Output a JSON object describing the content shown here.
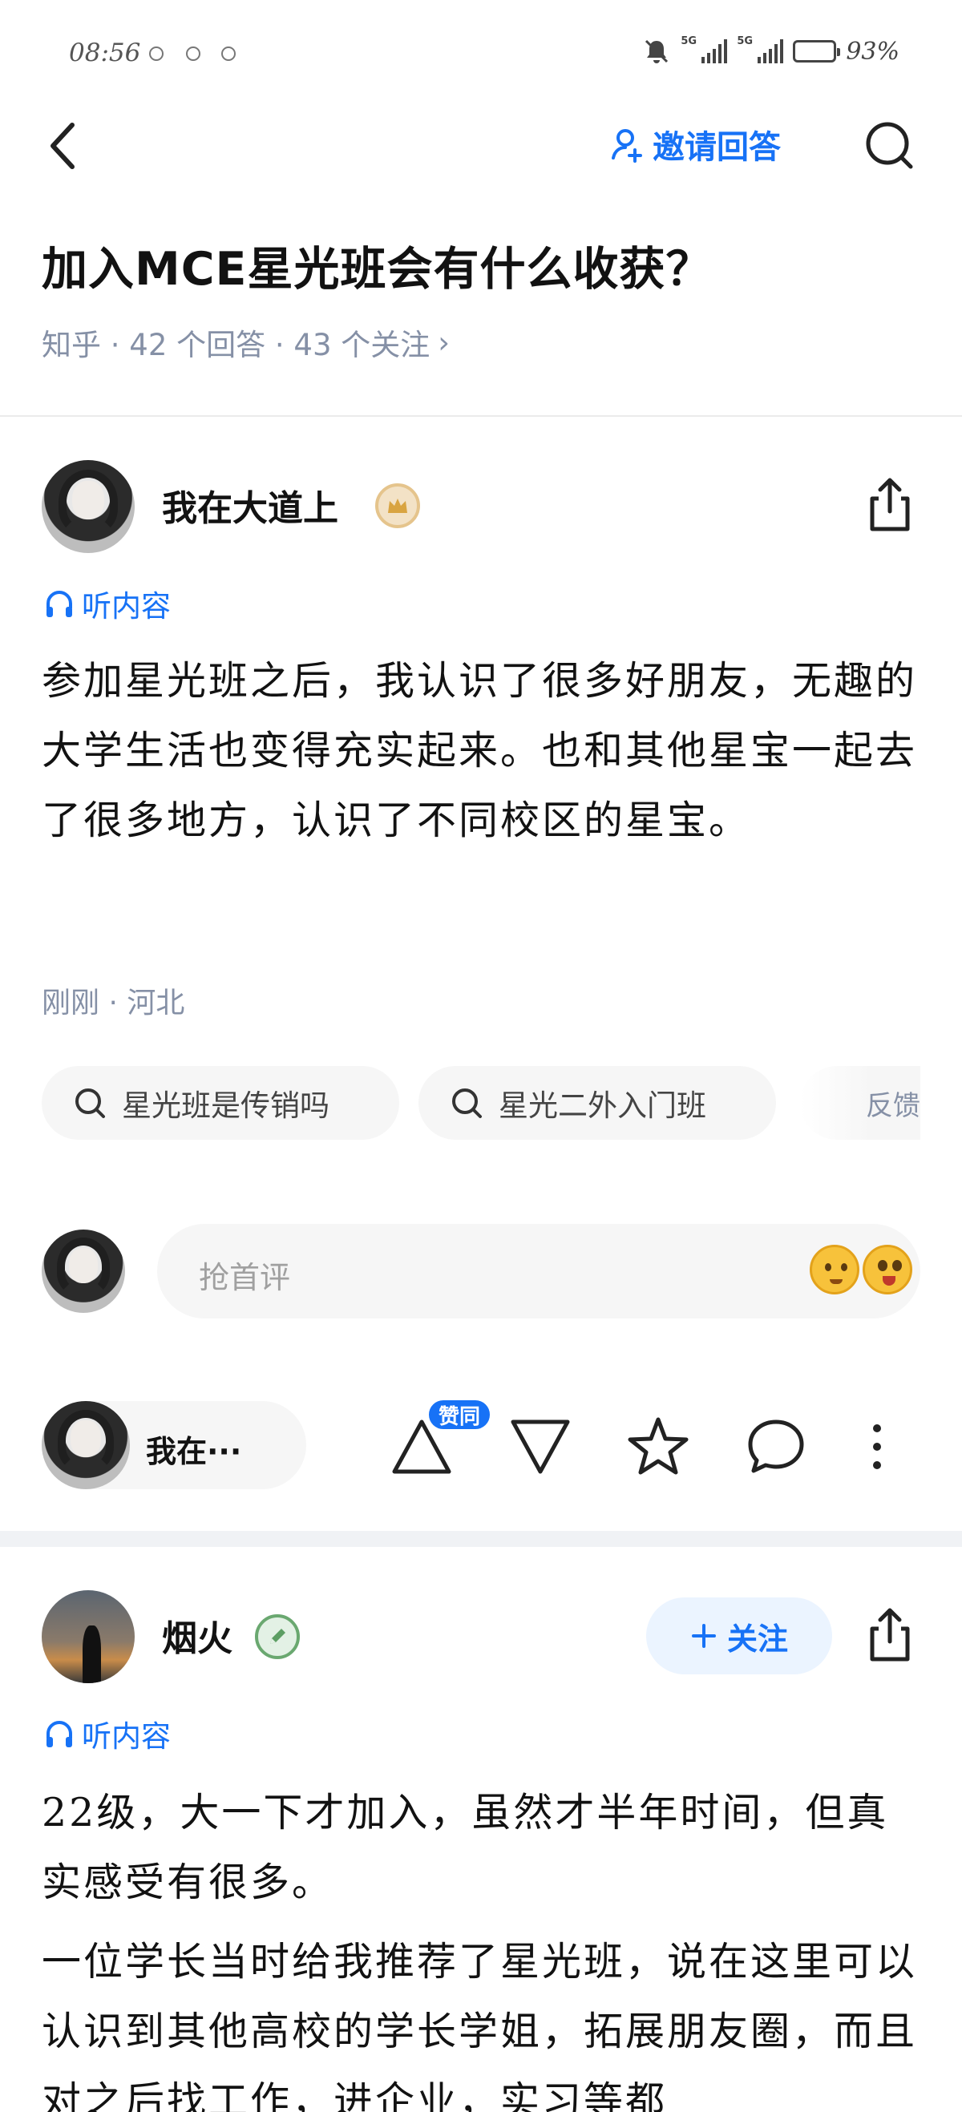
{
  "status_bar": {
    "time": "08:56",
    "network_1": "5G",
    "network_2": "5G",
    "battery": "93%"
  },
  "topbar": {
    "invite_label": "邀请回答"
  },
  "question": {
    "title": "加入MCE星光班会有什么收获？",
    "meta": "知乎 · 42 个回答 · 43 个关注",
    "meta_chevron": "›"
  },
  "answer1": {
    "author": "我在大道上",
    "listen_label": "听内容",
    "content": "参加星光班之后，我认识了很多好朋友，无趣的大学生活也变得充实起来。也和其他星宝一起去了很多地方，认识了不同校区的星宝。",
    "meta": "刚刚 · 河北",
    "related_searches": [
      "星光班是传销吗",
      "星光二外入门班"
    ],
    "feedback_label": "反馈",
    "comment_placeholder": "抢首评",
    "author_short": "我在···",
    "agree_badge": "赞同"
  },
  "answer2": {
    "author": "烟火",
    "follow_label": "关注",
    "listen_label": "听内容",
    "paragraph1": "22级，大一下才加入，虽然才半年时间，但真实感受有很多。",
    "paragraph2": "一位学长当时给我推荐了星光班，说在这里可以认识到其他高校的学长学姐，拓展朋友圈，而且对之后找工作，进企业，实习等都"
  },
  "colors": {
    "accent": "#1772f6",
    "meta_gray": "#8590a6",
    "separator": "#f0f2f5"
  }
}
